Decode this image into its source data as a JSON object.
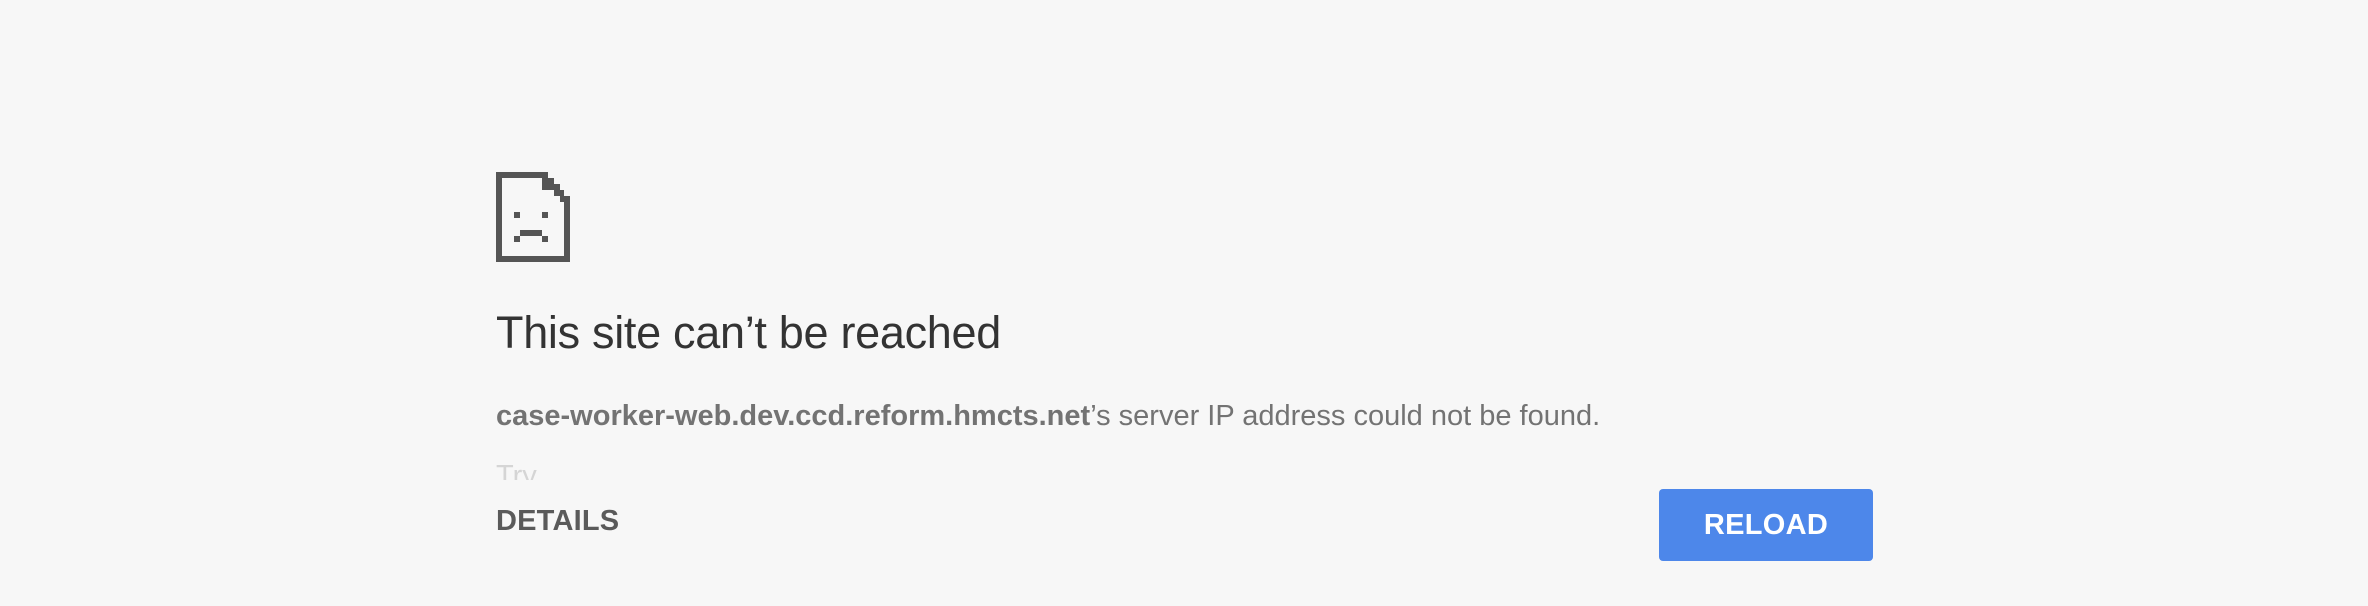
{
  "error": {
    "icon": "sad-page-icon",
    "title": "This site can’t be reached",
    "message": {
      "host": "case-worker-web.dev.ccd.reform.hmcts.net",
      "suffix": "’s server IP address could not be found."
    },
    "faded_text": "Try"
  },
  "buttons": {
    "details_label": "DETAILS",
    "reload_label": "RELOAD"
  },
  "colors": {
    "background": "#f7f7f7",
    "title": "#333333",
    "message": "#737373",
    "reload_button": "#4d87ea"
  }
}
